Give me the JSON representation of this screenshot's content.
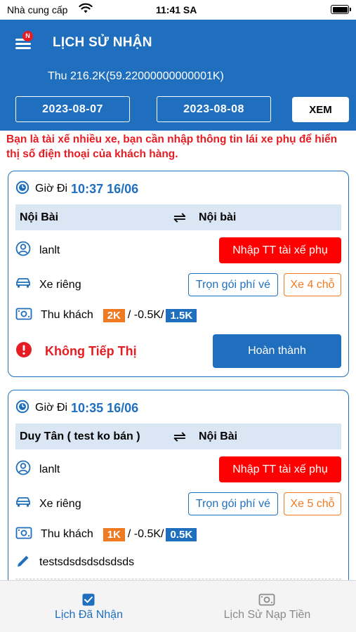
{
  "status_bar": {
    "carrier": "Nhà cung cấp",
    "time": "11:41 SA"
  },
  "header": {
    "title": "LỊCH SỬ NHẬN",
    "menu_badge": "N",
    "summary": "Thu 216.2K(59.22000000000001K)",
    "date_from": "2023-08-07",
    "date_to": "2023-08-08",
    "view_label": "XEM"
  },
  "warning": "Bạn là tài xế nhiều xe, bạn cần nhập thông tin lái xe phụ để hiển thị số điện thoại của khách hàng.",
  "trips": [
    {
      "time_label": "Giờ Đi",
      "time_value": "10:37 16/06",
      "from": "Nội Bài",
      "to": "Nội bài",
      "user": "lanlt",
      "driver_button": "Nhập TT tài xế phụ",
      "vehicle_type": "Xe riêng",
      "package_tag": "Trọn gói phí vé",
      "seat_tag": "Xe 4 chỗ",
      "fee_label": "Thu khách",
      "fee_amount": "2K",
      "fee_deduction": "/ -0.5K/",
      "fee_net": "1.5K",
      "status_text": "Không Tiếp Thị",
      "complete_button": "Hoàn thành"
    },
    {
      "time_label": "Giờ Đi",
      "time_value": "10:35 16/06",
      "from": "Duy Tân ( test ko bán )",
      "to": "Nội Bài",
      "user": "lanlt",
      "driver_button": "Nhập TT tài xế phụ",
      "vehicle_type": "Xe riêng",
      "package_tag": "Trọn gói phí vé",
      "seat_tag": "Xe 5 chỗ",
      "fee_label": "Thu khách",
      "fee_amount": "1K",
      "fee_deduction": "/ -0.5K/",
      "fee_net": "0.5K",
      "note": "testsdsdsdsdsdsds"
    }
  ],
  "tabs": [
    {
      "label": "Lịch Đã Nhận",
      "icon": "checkbox-icon",
      "active": true
    },
    {
      "label": "Lịch Sử Nạp Tiền",
      "icon": "money-icon",
      "active": false
    }
  ],
  "colors": {
    "primary": "#1f6fbe",
    "danger": "#e51d23",
    "accent": "#ee7a22",
    "route_bg": "#dae6f3"
  }
}
